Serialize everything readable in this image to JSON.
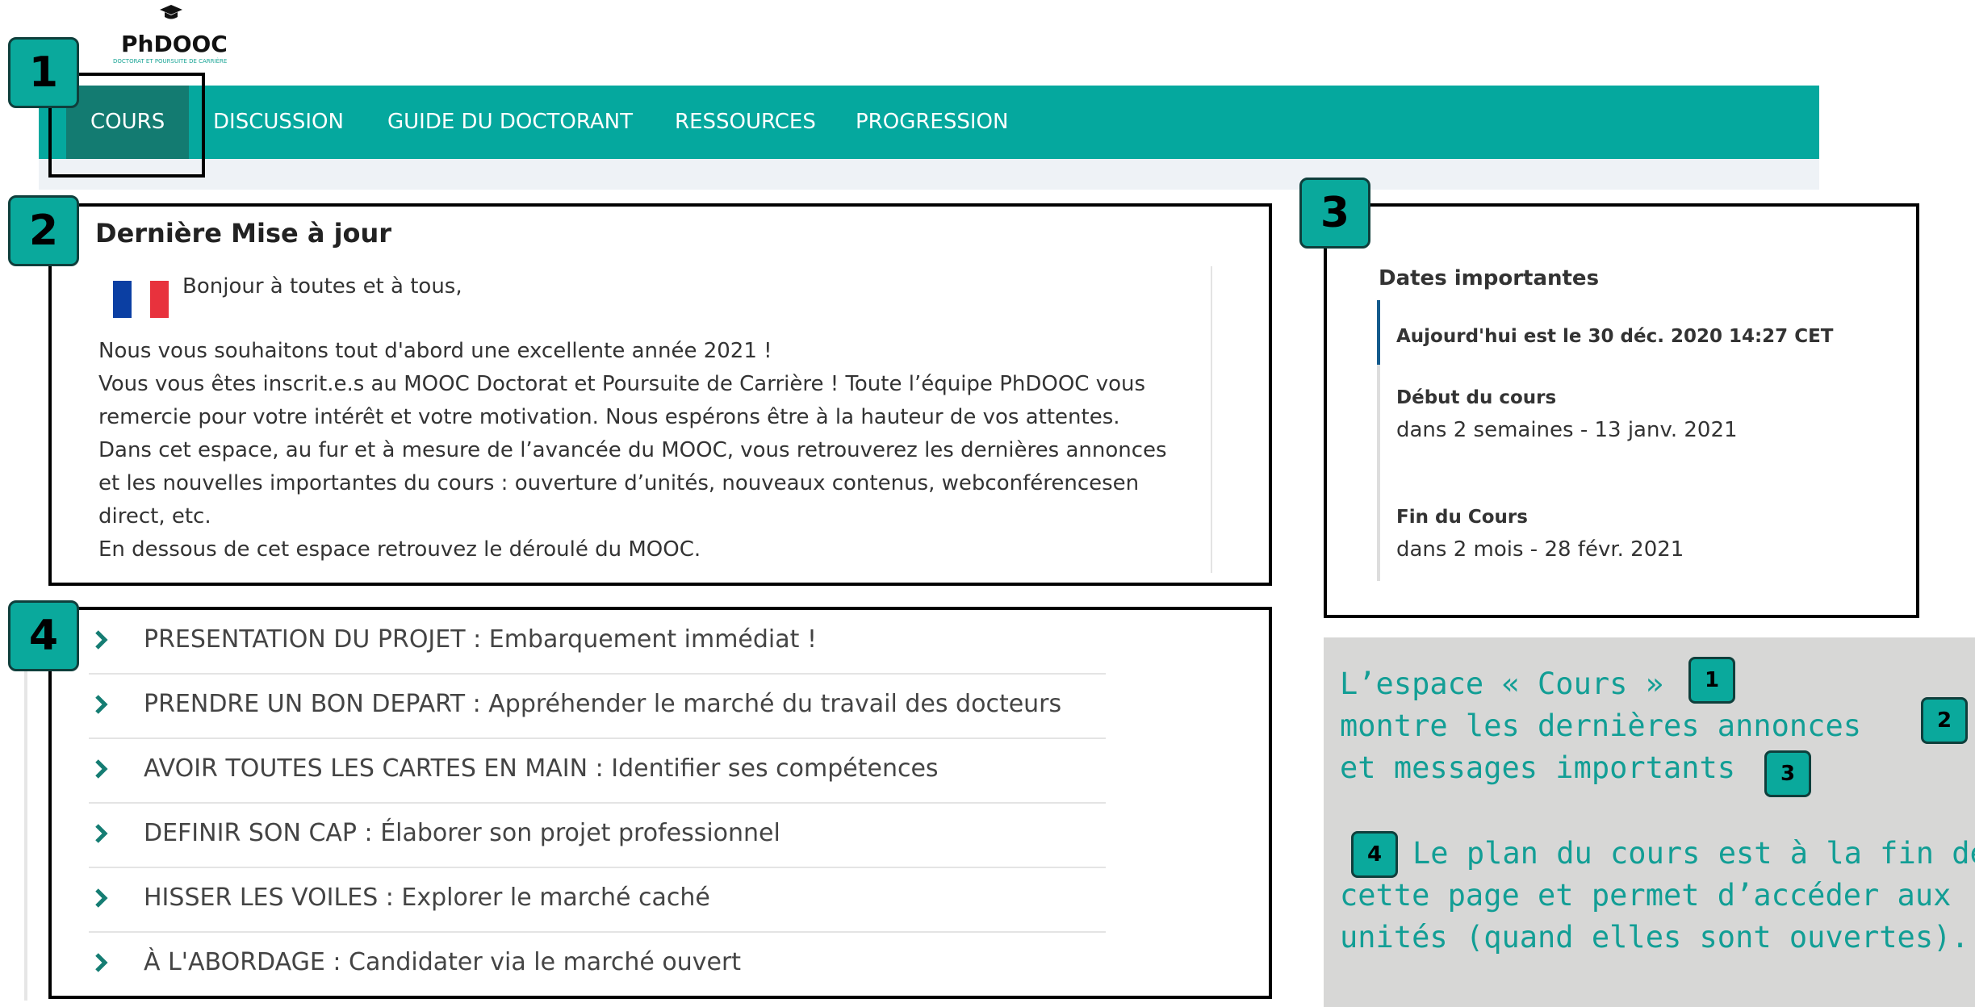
{
  "logo": {
    "name": "PhDOOC",
    "tagline": "DOCTORAT ET POURSUITE DE CARRIÈRE"
  },
  "nav": {
    "items": [
      "COURS",
      "DISCUSSION",
      "GUIDE DU DOCTORANT",
      "RESSOURCES",
      "PROGRESSION"
    ],
    "active": "COURS"
  },
  "badges": [
    "1",
    "2",
    "3",
    "4"
  ],
  "update": {
    "title": "Dernière Mise à jour",
    "greeting": "Bonjour à toutes et à tous,",
    "lines": [
      "Nous vous souhaitons tout d'abord une excellente année 2021 !",
      "Vous vous êtes inscrit.e.s au MOOC Doctorat et Poursuite de Carrière ! Toute l’équipe PhDOOC vous",
      "remercie pour votre intérêt et votre motivation. Nous espérons être à la hauteur de vos attentes.",
      "Dans cet espace, au fur et à mesure de l’avancée du MOOC, vous retrouverez les dernières annonces",
      "et les nouvelles importantes du cours : ouverture d’unités, nouveaux contenus, webconférencesen",
      "direct, etc.",
      "En dessous de cet espace retrouvez le déroulé du MOOC."
    ]
  },
  "dates": {
    "title": "Dates importantes",
    "today": "Aujourd'hui est le 30 déc. 2020 14:27 CET",
    "start_label": "Début du cours",
    "start_value": "dans 2 semaines - 13 janv. 2021",
    "end_label": "Fin du Cours",
    "end_value": "dans 2 mois - 28 févr. 2021"
  },
  "outline": [
    "PRESENTATION DU PROJET : Embarquement immédiat !",
    "PRENDRE UN BON DEPART : Appréhender le marché du travail des docteurs",
    "AVOIR TOUTES LES CARTES EN MAIN : Identifier ses compétences",
    "DEFINIR SON CAP : Élaborer son projet professionnel",
    "HISSER LES VOILES : Explorer le marché caché",
    "À L'ABORDAGE : Candidater via le marché ouvert"
  ],
  "info": {
    "line1": "L’espace « Cours »",
    "line2": "montre les dernières annonces",
    "line3": "et messages importants",
    "line4": "Le plan du cours est à la fin de",
    "line5": "cette page et permet d’accéder aux",
    "line6": "unités (quand elles sont ouvertes)."
  },
  "colors": {
    "teal": "#05a89e",
    "active_tab": "#137b71",
    "text_teal": "#129e95",
    "badge": "#0aa99c"
  }
}
